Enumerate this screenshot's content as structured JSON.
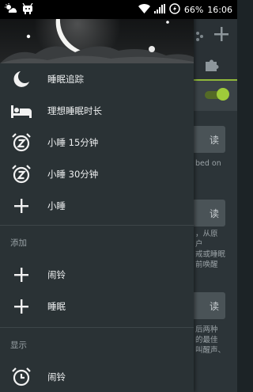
{
  "status_bar": {
    "battery_percent": "66%",
    "time": "16:06",
    "icons": [
      "weather-icon",
      "notification-icon",
      "wifi-icon",
      "signal-icon",
      "battery-icon"
    ]
  },
  "drawer": {
    "items": [
      {
        "icon": "moon-icon",
        "label": "睡眠追踪"
      },
      {
        "icon": "bed-icon",
        "label": "理想睡眠时长"
      },
      {
        "icon": "alarm-z-icon",
        "label": "小睡 15分钟"
      },
      {
        "icon": "alarm-z-icon",
        "label": "小睡 30分钟"
      },
      {
        "icon": "plus-icon",
        "label": "小睡"
      }
    ],
    "section_add": {
      "title": "添加",
      "items": [
        {
          "icon": "plus-icon",
          "label": "闹铃"
        },
        {
          "icon": "plus-icon",
          "label": "睡眠"
        }
      ]
    },
    "section_show": {
      "title": "显示",
      "items": [
        {
          "icon": "alarm-clock-icon",
          "label": "闹铃"
        }
      ]
    }
  },
  "background": {
    "buttons": [
      "读",
      "读",
      "读"
    ],
    "text_snippets": [
      "bed on",
      "，从原",
      "户",
      "戒或睡眠",
      "前唤醒",
      "后两种",
      "的最佳",
      "叫醒声、"
    ],
    "accent": "#9ecb3a"
  }
}
